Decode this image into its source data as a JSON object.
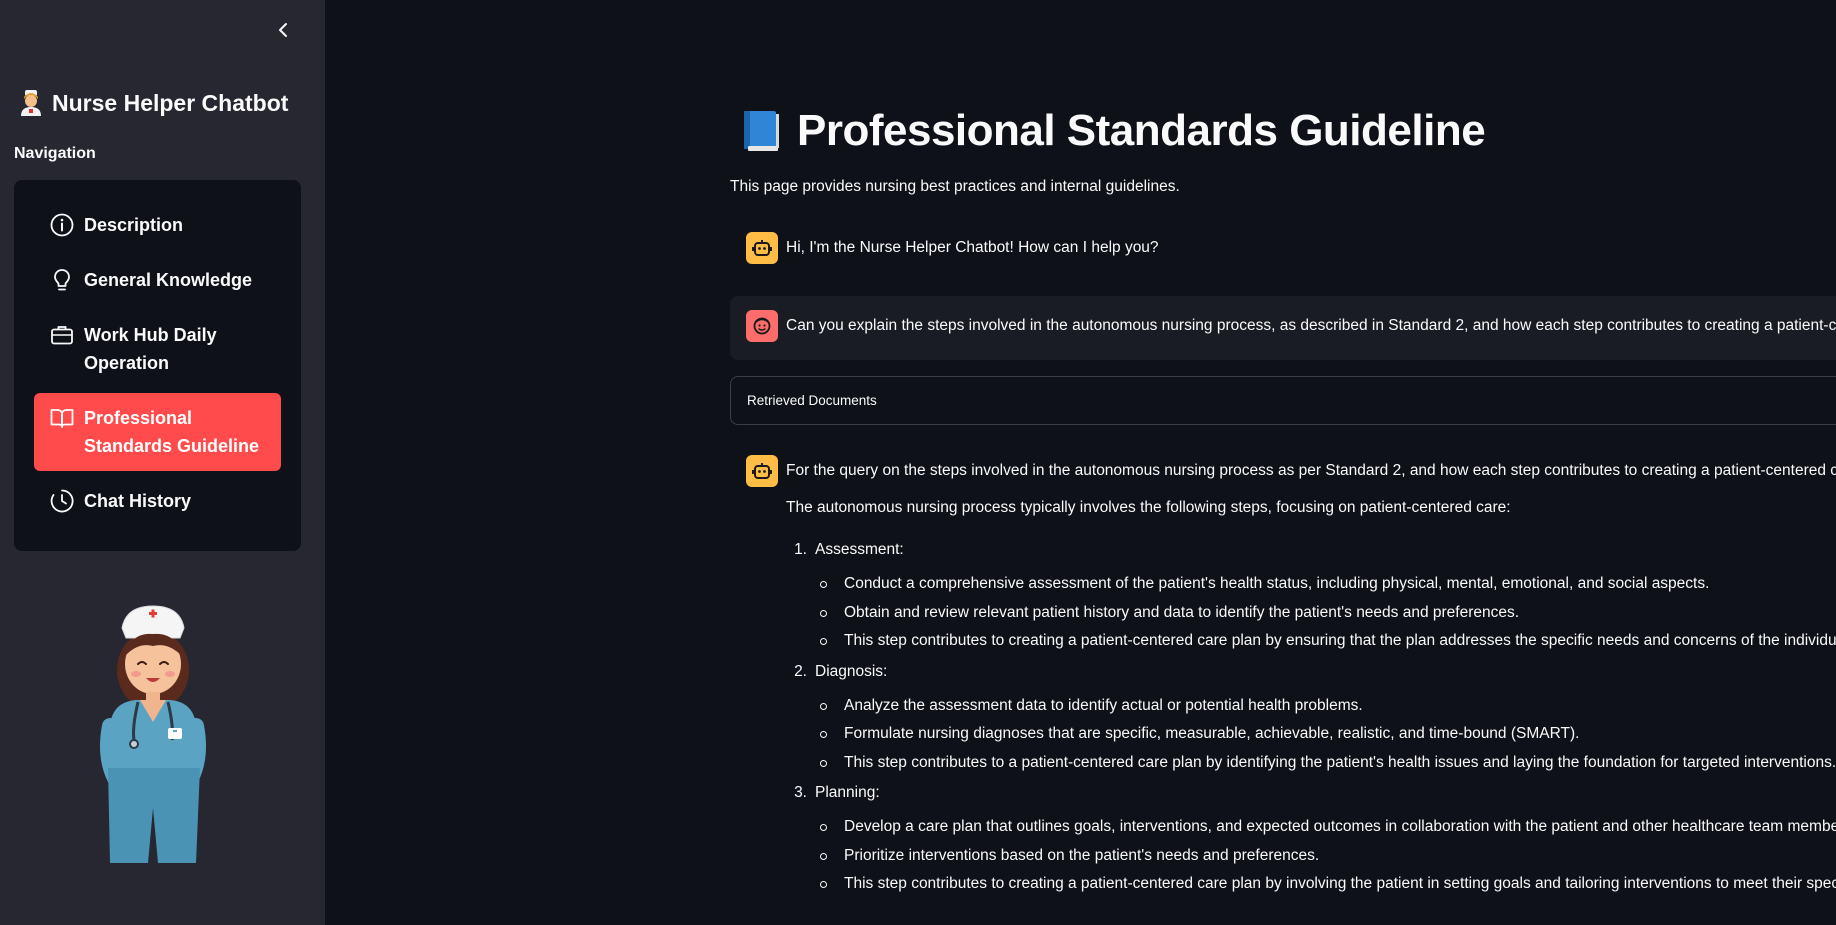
{
  "sidebar": {
    "app_title": "Nurse Helper Chatbot",
    "nav_heading": "Navigation",
    "items": [
      {
        "label": "Description",
        "icon": "info-circle-icon",
        "active": false
      },
      {
        "label": "General Knowledge",
        "icon": "lightbulb-icon",
        "active": false
      },
      {
        "label": "Work Hub Daily Operation",
        "icon": "briefcase-icon",
        "active": false
      },
      {
        "label": "Professional Standards Guideline",
        "icon": "book-open-icon",
        "active": true
      },
      {
        "label": "Chat History",
        "icon": "clock-icon",
        "active": false
      }
    ],
    "active_color": "#ff4b4b"
  },
  "main": {
    "title": "Professional Standards Guideline",
    "subtitle": "This page provides nursing best practices and internal guidelines.",
    "messages": {
      "greeting": "Hi, I'm the Nurse Helper Chatbot! How can I help you?",
      "user_question": "Can you explain the steps involved in the autonomous nursing process, as described in Standard 2, and how each step contributes to creating a patient-centered care plan"
    },
    "expander_label": "Retrieved Documents",
    "answer": {
      "first_line": "For the query on the steps involved in the autonomous nursing process as per Standard 2, and how each step contributes to creating a patient-centered care plan:",
      "intro": "The autonomous nursing process typically involves the following steps, focusing on patient-centered care:",
      "steps": [
        {
          "num": "1.",
          "title": "Assessment:",
          "bullets": [
            "Conduct a comprehensive assessment of the patient's health status, including physical, mental, emotional, and social aspects.",
            "Obtain and review relevant patient history and data to identify the patient's needs and preferences.",
            "This step contributes to creating a patient-centered care plan by ensuring that the plan addresses the specific needs and concerns of the individual patient."
          ]
        },
        {
          "num": "2.",
          "title": "Diagnosis:",
          "bullets": [
            "Analyze the assessment data to identify actual or potential health problems.",
            "Formulate nursing diagnoses that are specific, measurable, achievable, realistic, and time-bound (SMART).",
            "This step contributes to a patient-centered care plan by identifying the patient's health issues and laying the foundation for targeted interventions."
          ]
        },
        {
          "num": "3.",
          "title": "Planning:",
          "bullets": [
            "Develop a care plan that outlines goals, interventions, and expected outcomes in collaboration with the patient and other healthcare team members.",
            "Prioritize interventions based on the patient's needs and preferences.",
            "This step contributes to creating a patient-centered care plan by involving the patient in setting goals and tailoring interventions to meet their specific needs."
          ]
        }
      ]
    }
  },
  "colors": {
    "bot_avatar": "#ffbd45",
    "user_avatar": "#ff6c6c",
    "background": "#0e1117",
    "sidebar": "#262730"
  }
}
